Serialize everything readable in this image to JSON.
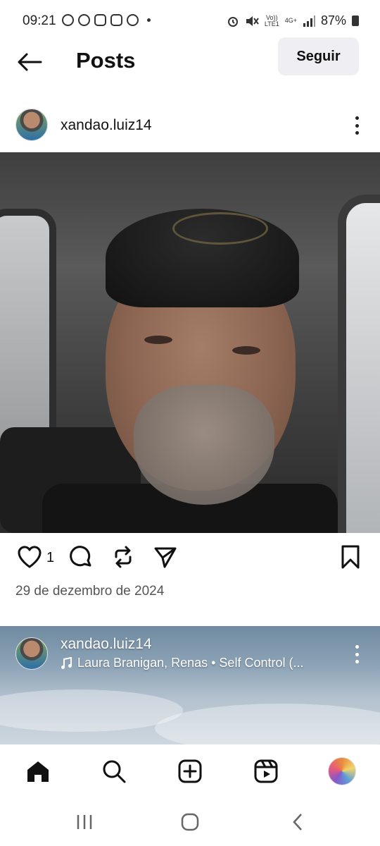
{
  "status_bar": {
    "time": "09:21",
    "network_label_top": "Vo))",
    "network_label_bottom": "LTE1",
    "network_type": "4G+",
    "battery": "87%"
  },
  "header": {
    "title": "Posts",
    "follow_label": "Seguir"
  },
  "post": {
    "username": "xandao.luiz14",
    "likes": "1",
    "date": "29 de dezembro de 2024"
  },
  "next_post": {
    "username": "xandao.luiz14",
    "music": "Laura Branigan, Renas • Self Control (..."
  },
  "colors": {
    "follow_button_bg": "#efeff3",
    "text_primary": "#111111",
    "text_secondary": "#555555"
  },
  "icons": {
    "bottom_nav": [
      "home-icon",
      "search-icon",
      "create-icon",
      "reels-icon",
      "profile-avatar"
    ],
    "actions": [
      "heart-icon",
      "comment-icon",
      "repost-icon",
      "share-icon",
      "save-icon"
    ]
  }
}
